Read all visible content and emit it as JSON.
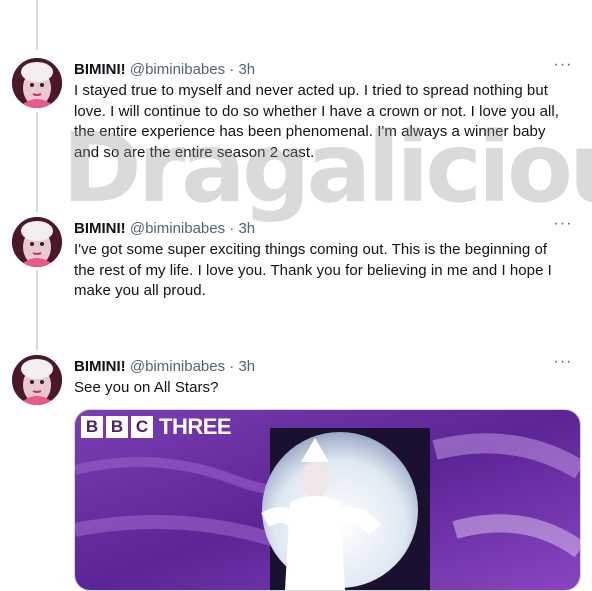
{
  "previous_tweet_fragment": "·",
  "tweets": [
    {
      "display_name": "BIMINI!",
      "handle": "@biminibabes",
      "separator": "·",
      "time": "3h",
      "text": "I stayed true to myself and never acted up. I tried to spread nothing but love. I will continue to do so whether I have a crown or not. I love you all, the entire experience has been phenomenal. I'm always a winner baby and so are the entire season 2 cast."
    },
    {
      "display_name": "BIMINI!",
      "handle": "@biminibabes",
      "separator": "·",
      "time": "3h",
      "text": "I've got some super exciting things coming out. This is the beginning of the rest of my life. I love you. Thank you for believing in me and I hope I make you all proud."
    },
    {
      "display_name": "BIMINI!",
      "handle": "@biminibabes",
      "separator": "·",
      "time": "3h",
      "text": "See you on All Stars?",
      "media": {
        "logo_letters": [
          "B",
          "B",
          "C"
        ],
        "logo_word": "THREE"
      }
    }
  ],
  "more_label": "···",
  "watermark": "Dragalicious",
  "colors": {
    "thread_line": "#cfd9de",
    "meta_text": "#536471",
    "media_purple": "#6a2c9c"
  }
}
